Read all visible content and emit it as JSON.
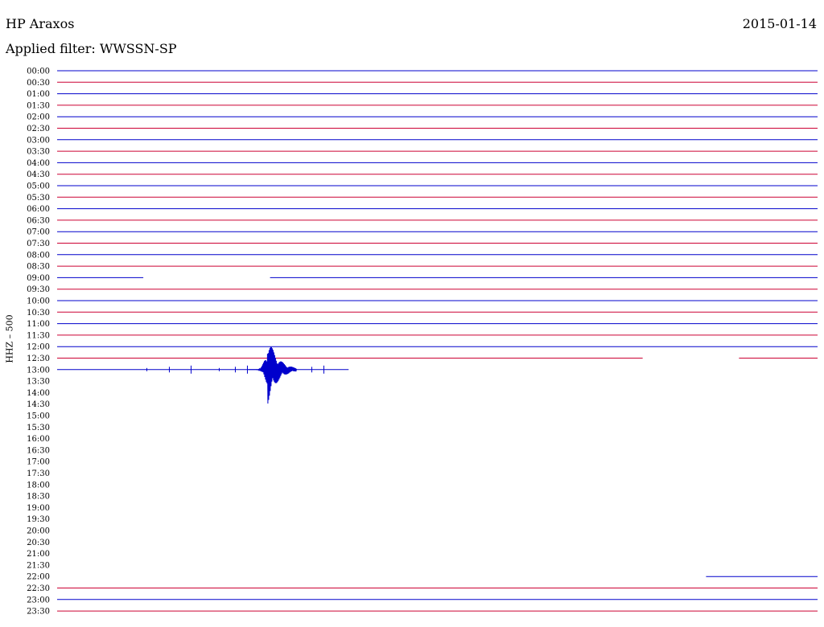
{
  "header": {
    "station": "HP Araxos",
    "filter": "Applied filter: WWSSN-SP",
    "date": "2015-01-14"
  },
  "chart_data": {
    "type": "line",
    "title": "HP Araxos",
    "ylabel": "HHZ – 500",
    "y_ticks": [
      "00:00",
      "00:30",
      "01:00",
      "01:30",
      "02:00",
      "02:30",
      "03:00",
      "03:30",
      "04:00",
      "04:30",
      "05:00",
      "05:30",
      "06:00",
      "06:30",
      "07:00",
      "07:30",
      "08:00",
      "08:30",
      "09:00",
      "09:30",
      "10:00",
      "10:30",
      "11:00",
      "11:30",
      "12:00",
      "12:30",
      "13:00",
      "13:30",
      "14:00",
      "14:30",
      "15:00",
      "15:30",
      "16:00",
      "16:30",
      "17:00",
      "17:30",
      "18:00",
      "18:30",
      "19:00",
      "19:30",
      "20:00",
      "20:30",
      "21:00",
      "21:30",
      "22:00",
      "22:30",
      "23:00",
      "23:30"
    ],
    "trace_colors": [
      "#0000cc",
      "#cc0033"
    ],
    "trace_coverage_minutes": [
      [
        [
          0,
          30
        ]
      ],
      [
        [
          0,
          30
        ]
      ],
      [
        [
          0,
          30
        ]
      ],
      [
        [
          0,
          30
        ]
      ],
      [
        [
          0,
          30
        ]
      ],
      [
        [
          0,
          30
        ]
      ],
      [
        [
          0,
          30
        ]
      ],
      [
        [
          0,
          30
        ]
      ],
      [
        [
          0,
          30
        ]
      ],
      [
        [
          0,
          30
        ]
      ],
      [
        [
          0,
          30
        ]
      ],
      [
        [
          0,
          30
        ]
      ],
      [
        [
          0,
          30
        ]
      ],
      [
        [
          0,
          30
        ]
      ],
      [
        [
          0,
          30
        ]
      ],
      [
        [
          0,
          30
        ]
      ],
      [
        [
          0,
          30
        ]
      ],
      [
        [
          0,
          30
        ]
      ],
      [
        [
          0,
          3.4
        ],
        [
          8.4,
          30
        ]
      ],
      [
        [
          0,
          30
        ]
      ],
      [
        [
          0,
          30
        ]
      ],
      [
        [
          0,
          30
        ]
      ],
      [
        [
          0,
          30
        ]
      ],
      [
        [
          0,
          30
        ]
      ],
      [
        [
          0,
          30
        ]
      ],
      [
        [
          0,
          23.1
        ],
        [
          26.9,
          30
        ]
      ],
      [
        [
          0,
          11.5
        ]
      ],
      [],
      [],
      [],
      [],
      [],
      [],
      [],
      [],
      [],
      [],
      [],
      [],
      [],
      [],
      [],
      [],
      [],
      [
        [
          25.6,
          30
        ]
      ],
      [
        [
          0,
          30
        ]
      ],
      [
        [
          0,
          30
        ]
      ],
      [
        [
          0,
          30
        ]
      ]
    ],
    "events": [
      {
        "row": "13:00",
        "minute": 8.3,
        "label": "earthquake"
      }
    ]
  }
}
